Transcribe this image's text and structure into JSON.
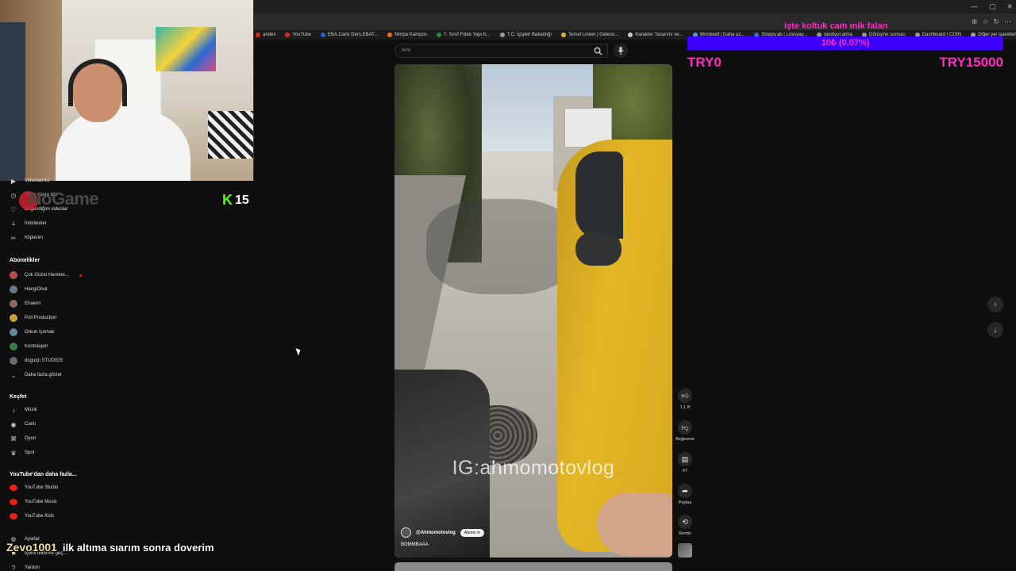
{
  "browser": {
    "window_controls": [
      "—",
      "▢",
      "✕"
    ],
    "bookmarks": [
      {
        "label": "andex",
        "color": "#e02828"
      },
      {
        "label": "YouTube",
        "color": "#e02828"
      },
      {
        "label": "EBA,Canlı Ders,EBAT...",
        "color": "#2962c9"
      },
      {
        "label": "Morpa Kampüs",
        "color": "#e8701a"
      },
      {
        "label": "7. Sınıf Fiilde Yapı K...",
        "color": "#2b8b3a"
      },
      {
        "label": "T.C. İçişleri Bakanlığı",
        "color": "#9a9a9a"
      },
      {
        "label": "Temel Lineer | Gelece...",
        "color": "#d6b12a"
      },
      {
        "label": "Karakter Tasarımı ve...",
        "color": "#cccccc"
      },
      {
        "label": "Wordwall | Daha az...",
        "color": "#3aa3e0"
      },
      {
        "label": "Sloppy.ab | Lossyay...",
        "color": "#3a6ad6"
      },
      {
        "label": "tandiyor.alma",
        "color": "#999999"
      },
      {
        "label": "Görüşme sonrası",
        "color": "#999999"
      },
      {
        "label": "Dashboard | COIN",
        "color": "#999999"
      },
      {
        "label": "Diğer yer işaretleri",
        "color": "#999999"
      }
    ]
  },
  "overlay": {
    "brand": "NoGame",
    "kick_count": "15",
    "chat_user": "Zevo1001",
    "chat_message": "ilk altıma sıarım sonra doverim"
  },
  "donation": {
    "title": "işte koltuk cam mik falan",
    "amount_text": "10₺ (0.07%)",
    "progress_pct": 0.07,
    "min_label": "TRY0",
    "max_label": "TRY15000",
    "bar_color": "#3b00ff",
    "text_color": "#ff2bc2"
  },
  "sidebar": {
    "top_items": [
      {
        "label": "Videolarınız",
        "icon": "play-icon"
      },
      {
        "label": "Daha sonra izle",
        "icon": "clock-icon"
      },
      {
        "label": "Beğendiğim videolar",
        "icon": "thumb-up-icon"
      },
      {
        "label": "İndirilenler",
        "icon": "download-icon"
      },
      {
        "label": "Kliplerim",
        "icon": "scissors-icon"
      }
    ],
    "subscriptions_title": "Abonelikler",
    "subscriptions": [
      {
        "label": "Çok Güzel Hareket...",
        "color": "#b84a4a",
        "live": true
      },
      {
        "label": "HangiOnur",
        "color": "#6a7a8a",
        "live": false
      },
      {
        "label": "Elraenn",
        "color": "#8a6a5a",
        "live": false
      },
      {
        "label": "Poll Production",
        "color": "#c8a040",
        "live": false
      },
      {
        "label": "Orkun Işıtmak",
        "color": "#5a8a9a",
        "live": false
      },
      {
        "label": "Kontraspor",
        "color": "#3a7a4a",
        "live": false
      },
      {
        "label": "doguqn STUDIOS",
        "color": "#6a6a6a",
        "live": false
      }
    ],
    "show_more": "Daha fazla göster",
    "explore_title": "Keşfet",
    "explore": [
      {
        "label": "Müzik",
        "icon": "music-icon"
      },
      {
        "label": "Canlı",
        "icon": "live-icon"
      },
      {
        "label": "Oyun",
        "icon": "gamepad-icon"
      },
      {
        "label": "Spor",
        "icon": "trophy-icon"
      }
    ],
    "more_title": "YouTube'dan daha fazla...",
    "more": [
      {
        "label": "YouTube Studio"
      },
      {
        "label": "YouTube Music"
      },
      {
        "label": "YouTube Kids"
      }
    ],
    "bottom": [
      {
        "label": "Ayarlar",
        "icon": "gear-icon"
      },
      {
        "label": "İçerik bildirme geç...",
        "icon": "flag-icon"
      },
      {
        "label": "Yardım",
        "icon": "help-icon"
      }
    ]
  },
  "search": {
    "placeholder": "Ara"
  },
  "video": {
    "watermark": "IG:ahmomotovlog",
    "channel": "@Ahmomotovlog",
    "subscribe": "Abone ol",
    "caption": "BOMMBAAA"
  },
  "actions": {
    "like_count": "1,1 B",
    "dislike_label": "Beğenme",
    "comment_count": "67",
    "share_label": "Paylaş",
    "remix_label": "Remix"
  }
}
